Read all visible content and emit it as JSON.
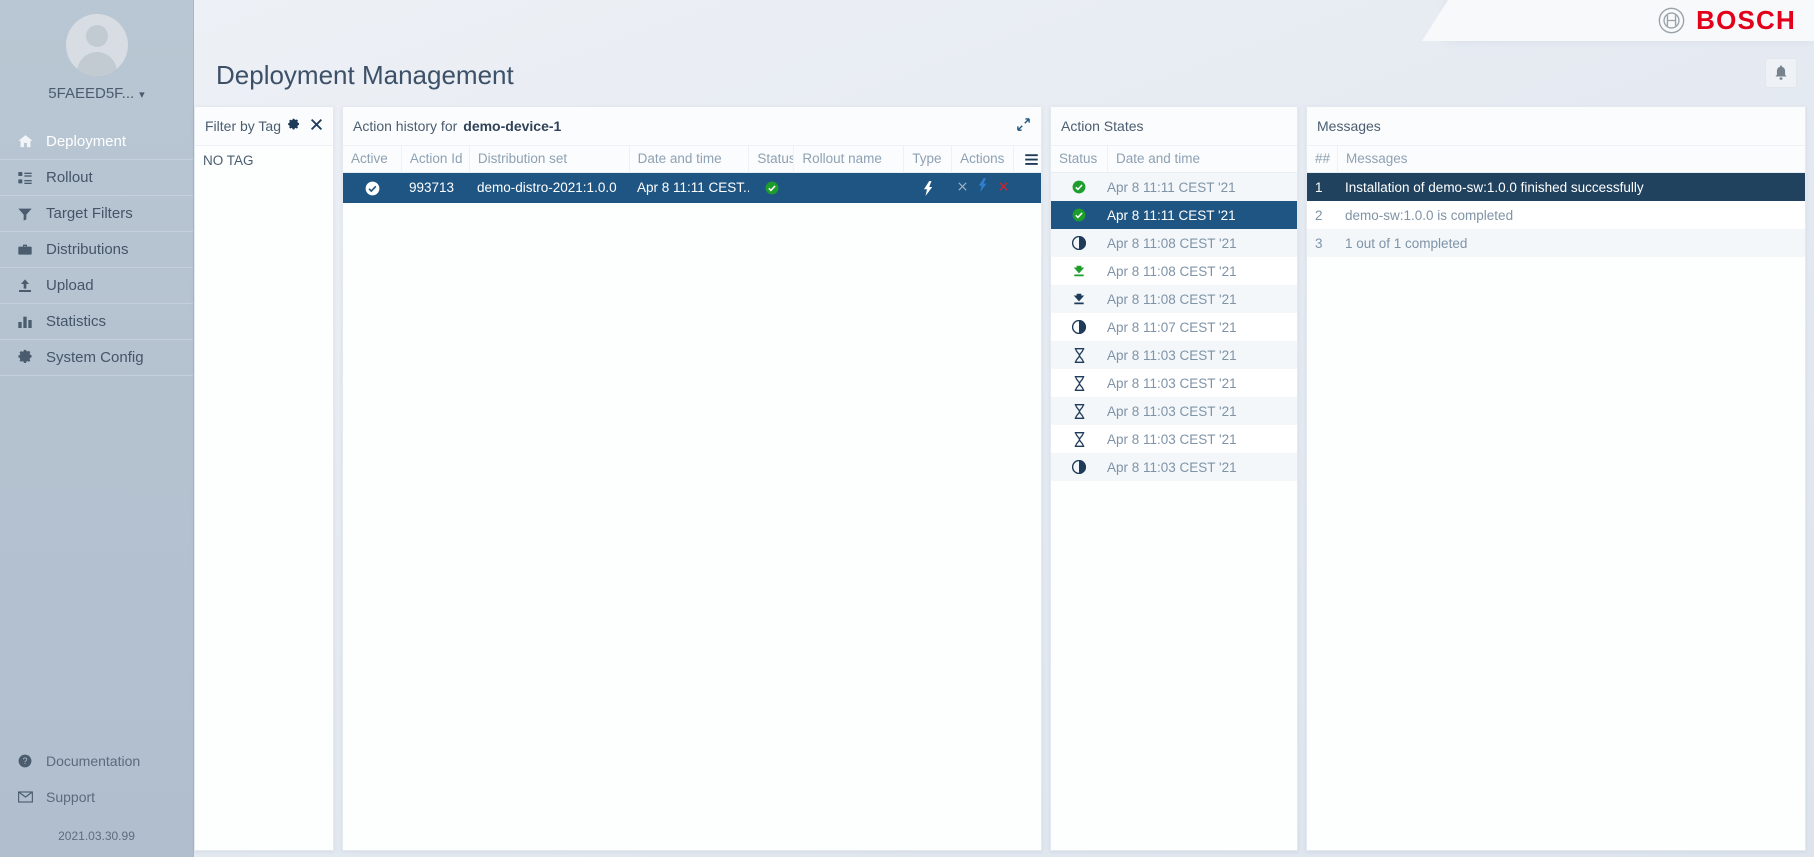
{
  "brand": {
    "name": "BOSCH",
    "mark_icon": "bosch-emblem-icon",
    "accent": "#e2001a"
  },
  "header": {
    "page_title": "Deployment Management",
    "bell_icon": "notification-bell-icon"
  },
  "sidebar": {
    "user": {
      "name": "5FAEED5F...",
      "caret": "⌄",
      "avatar_icon": "user-avatar-icon"
    },
    "items": [
      {
        "label": "Deployment",
        "icon": "home-icon",
        "active": true
      },
      {
        "label": "Rollout",
        "icon": "list-icon",
        "active": false
      },
      {
        "label": "Target Filters",
        "icon": "funnel-icon",
        "active": false
      },
      {
        "label": "Distributions",
        "icon": "briefcase-icon",
        "active": false
      },
      {
        "label": "Upload",
        "icon": "upload-icon",
        "active": false
      },
      {
        "label": "Statistics",
        "icon": "bar-chart-icon",
        "active": false
      },
      {
        "label": "System Config",
        "icon": "gear-icon",
        "active": false
      }
    ],
    "bottom": [
      {
        "label": "Documentation",
        "icon": "help-circle-icon"
      },
      {
        "label": "Support",
        "icon": "envelope-icon"
      }
    ],
    "version": "2021.03.30.99"
  },
  "filter_panel": {
    "title": "Filter by Tag",
    "gear_icon": "gear-icon",
    "close_icon": "close-icon",
    "no_tag_label": "NO TAG"
  },
  "history_panel": {
    "title": "Action history for",
    "device": "demo-device-1",
    "maximize_icon": "maximize-icon",
    "menu_icon": "hamburger-menu-icon",
    "columns": [
      "Active",
      "Action Id",
      "Distribution set",
      "Date and time",
      "Status",
      "Rollout name",
      "Type",
      "Actions"
    ],
    "rows": [
      {
        "active_icon": "check-circle-icon",
        "action_id": "993713",
        "distribution_set": "demo-distro-2021:1.0.0",
        "date_time": "Apr 8 11:11 CEST...",
        "status_icon": "check-circle-green-icon",
        "rollout_name": "",
        "type_icon": "lightning-bolt-icon",
        "actions": [
          "cancel-icon",
          "force-quit-icon",
          "delete-icon"
        ],
        "selected": true
      }
    ]
  },
  "states_panel": {
    "title": "Action States",
    "columns": [
      "Status",
      "Date and time"
    ],
    "rows": [
      {
        "icon": "check-circle-green-icon",
        "date_time": "Apr 8 11:11 CEST '21",
        "selected": false
      },
      {
        "icon": "check-circle-green-icon",
        "date_time": "Apr 8 11:11 CEST '21",
        "selected": true
      },
      {
        "icon": "half-circle-icon",
        "date_time": "Apr 8 11:08 CEST '21",
        "selected": false
      },
      {
        "icon": "download-green-icon",
        "date_time": "Apr 8 11:08 CEST '21",
        "selected": false
      },
      {
        "icon": "download-dark-icon",
        "date_time": "Apr 8 11:08 CEST '21",
        "selected": false
      },
      {
        "icon": "half-circle-icon",
        "date_time": "Apr 8 11:07 CEST '21",
        "selected": false
      },
      {
        "icon": "hourglass-icon",
        "date_time": "Apr 8 11:03 CEST '21",
        "selected": false
      },
      {
        "icon": "hourglass-icon",
        "date_time": "Apr 8 11:03 CEST '21",
        "selected": false
      },
      {
        "icon": "hourglass-icon",
        "date_time": "Apr 8 11:03 CEST '21",
        "selected": false
      },
      {
        "icon": "hourglass-icon",
        "date_time": "Apr 8 11:03 CEST '21",
        "selected": false
      },
      {
        "icon": "half-circle-icon",
        "date_time": "Apr 8 11:03 CEST '21",
        "selected": false
      }
    ]
  },
  "messages_panel": {
    "title": "Messages",
    "columns": [
      "##",
      "Messages"
    ],
    "rows": [
      {
        "num": "1",
        "text": "Installation of demo-sw:1.0.0 finished successfully",
        "selected": true
      },
      {
        "num": "2",
        "text": "demo-sw:1.0.0 is completed",
        "selected": false
      },
      {
        "num": "3",
        "text": "1 out of 1 completed",
        "selected": false
      }
    ]
  }
}
